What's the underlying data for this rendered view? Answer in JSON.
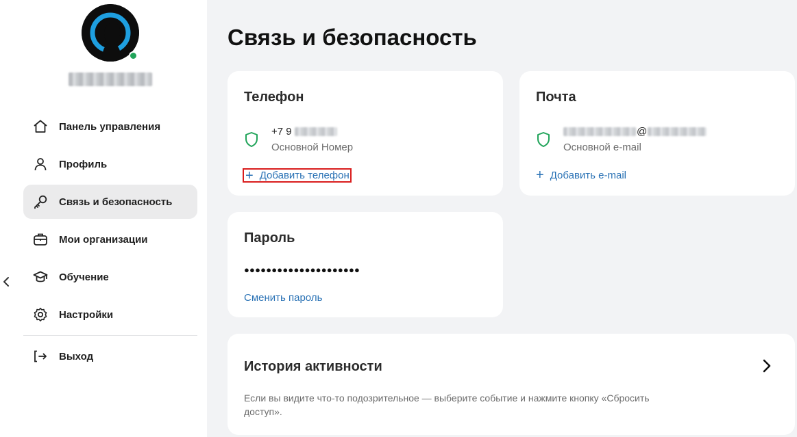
{
  "sidebar": {
    "collapse_icon": "chevron-left-icon",
    "avatar_icon": "user-silhouette-icon",
    "online_color": "#21a45a",
    "items": [
      {
        "label": "Панель управления",
        "icon": "home-icon",
        "active": false
      },
      {
        "label": "Профиль",
        "icon": "user-icon",
        "active": false
      },
      {
        "label": "Связь и безопасность",
        "icon": "key-icon",
        "active": true
      },
      {
        "label": "Мои организации",
        "icon": "briefcase-icon",
        "active": false
      },
      {
        "label": "Обучение",
        "icon": "graduation-cap-icon",
        "active": false
      },
      {
        "label": "Настройки",
        "icon": "gear-icon",
        "active": false
      }
    ],
    "logout": {
      "label": "Выход",
      "icon": "logout-icon"
    }
  },
  "main": {
    "title": "Связь и безопасность",
    "phone_card": {
      "title": "Телефон",
      "number_prefix": "+7 9",
      "subtitle": "Основной Номер",
      "add_label": "Добавить телефон"
    },
    "mail_card": {
      "title": "Почта",
      "at_symbol": "@",
      "subtitle": "Основной e-mail",
      "add_label": "Добавить e-mail"
    },
    "password_card": {
      "title": "Пароль",
      "masked": "●●●●●●●●●●●●●●●●●●●●●",
      "change_label": "Сменить пароль"
    },
    "history_card": {
      "title": "История активности",
      "description": "Если вы видите что-то подозрительное — выберите событие и нажмите кнопку «Сбросить доступ»."
    }
  },
  "colors": {
    "accent": "#2a72b5",
    "shield": "#21a45a",
    "active_bg": "#ebebec",
    "page_bg": "#f2f3f5",
    "highlight_border": "#d91c1c"
  }
}
